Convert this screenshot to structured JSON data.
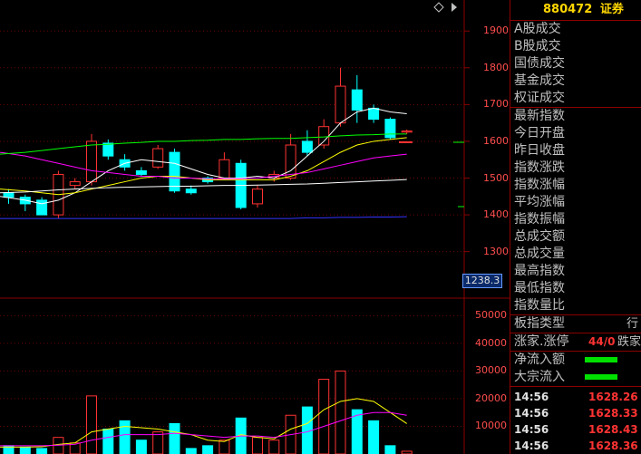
{
  "header": {
    "code": "880472",
    "name": "证券"
  },
  "price_axis": [
    "1900",
    "1800",
    "1700",
    "1600",
    "1500",
    "1400",
    "1300"
  ],
  "price_current_label": "1238.3",
  "volume_axis": [
    "50000",
    "40000",
    "30000",
    "20000",
    "10000"
  ],
  "side_groups": [
    [
      "A股成交",
      "B股成交",
      "国债成交",
      "基金成交",
      "权证成交"
    ],
    [
      "最新指数",
      "今日开盘",
      "昨日收盘",
      "指数涨跌",
      "指数涨幅",
      "平均涨幅",
      "指数振幅",
      "总成交额",
      "总成交量",
      "最高指数",
      "最低指数",
      "指数量比"
    ]
  ],
  "board_type": {
    "label": "板指类型",
    "value": "行"
  },
  "up_down": {
    "label": "涨家.涨停",
    "value": "44/0",
    "extra": "跌家"
  },
  "net_inflow": {
    "label": "净流入额"
  },
  "block_inflow": {
    "label": "大宗流入"
  },
  "ticks": [
    {
      "time": "14:56",
      "price": "1628.26"
    },
    {
      "time": "14:56",
      "price": "1628.33"
    },
    {
      "time": "14:56",
      "price": "1628.43"
    },
    {
      "time": "14:56",
      "price": "1628.36"
    }
  ],
  "chart_data": {
    "type": "candlestick",
    "ylim": [
      1240,
      1940
    ],
    "candles": [
      {
        "o": 1460,
        "c": 1448,
        "h": 1470,
        "l": 1430,
        "v": 3000
      },
      {
        "o": 1448,
        "c": 1430,
        "h": 1455,
        "l": 1410,
        "v": 2500
      },
      {
        "o": 1440,
        "c": 1400,
        "h": 1448,
        "l": 1400,
        "v": 2000
      },
      {
        "o": 1400,
        "c": 1510,
        "h": 1520,
        "l": 1390,
        "v": 6000
      },
      {
        "o": 1480,
        "c": 1490,
        "h": 1500,
        "l": 1470,
        "v": 4000
      },
      {
        "o": 1490,
        "c": 1600,
        "h": 1620,
        "l": 1480,
        "v": 21000
      },
      {
        "o": 1595,
        "c": 1560,
        "h": 1605,
        "l": 1550,
        "v": 9000
      },
      {
        "o": 1550,
        "c": 1530,
        "h": 1565,
        "l": 1520,
        "v": 12000
      },
      {
        "o": 1520,
        "c": 1510,
        "h": 1530,
        "l": 1505,
        "v": 5000
      },
      {
        "o": 1530,
        "c": 1580,
        "h": 1590,
        "l": 1525,
        "v": 8000
      },
      {
        "o": 1570,
        "c": 1465,
        "h": 1580,
        "l": 1460,
        "v": 11000
      },
      {
        "o": 1470,
        "c": 1460,
        "h": 1480,
        "l": 1455,
        "v": 2000
      },
      {
        "o": 1500,
        "c": 1490,
        "h": 1505,
        "l": 1485,
        "v": 3000
      },
      {
        "o": 1500,
        "c": 1550,
        "h": 1570,
        "l": 1495,
        "v": 5000
      },
      {
        "o": 1540,
        "c": 1420,
        "h": 1550,
        "l": 1415,
        "v": 13000
      },
      {
        "o": 1430,
        "c": 1470,
        "h": 1480,
        "l": 1420,
        "v": 6000
      },
      {
        "o": 1500,
        "c": 1510,
        "h": 1520,
        "l": 1490,
        "v": 5000
      },
      {
        "o": 1500,
        "c": 1590,
        "h": 1620,
        "l": 1495,
        "v": 14000
      },
      {
        "o": 1600,
        "c": 1570,
        "h": 1630,
        "l": 1560,
        "v": 17000
      },
      {
        "o": 1590,
        "c": 1640,
        "h": 1660,
        "l": 1580,
        "v": 27000
      },
      {
        "o": 1650,
        "c": 1750,
        "h": 1800,
        "l": 1640,
        "v": 30000
      },
      {
        "o": 1740,
        "c": 1685,
        "h": 1780,
        "l": 1650,
        "v": 16000
      },
      {
        "o": 1690,
        "c": 1660,
        "h": 1700,
        "l": 1650,
        "v": 12000
      },
      {
        "o": 1660,
        "c": 1610,
        "h": 1665,
        "l": 1605,
        "v": 3000
      },
      {
        "o": 1625,
        "c": 1628,
        "h": 1632,
        "l": 1620,
        "v": 1000
      }
    ],
    "ma_lines": [
      {
        "color": "#ffffff",
        "values": [
          1450,
          1440,
          1430,
          1440,
          1460,
          1490,
          1520,
          1540,
          1550,
          1545,
          1540,
          1525,
          1510,
          1500,
          1500,
          1505,
          1500,
          1520,
          1560,
          1600,
          1650,
          1680,
          1690,
          1680,
          1675
        ]
      },
      {
        "color": "#ffff00",
        "values": [
          1470,
          1465,
          1460,
          1455,
          1460,
          1470,
          1480,
          1490,
          1500,
          1505,
          1505,
          1500,
          1495,
          1495,
          1495,
          1495,
          1495,
          1505,
          1520,
          1545,
          1570,
          1590,
          1600,
          1605,
          1610
        ]
      },
      {
        "color": "#ff00ff",
        "values": [
          1570,
          1560,
          1550,
          1540,
          1530,
          1520,
          1515,
          1510,
          1505,
          1505,
          1500,
          1500,
          1498,
          1498,
          1498,
          1500,
          1505,
          1510,
          1515,
          1525,
          1535,
          1545,
          1555,
          1560,
          1565
        ]
      },
      {
        "color": "#00ff00",
        "values": [
          1565,
          1570,
          1575,
          1580,
          1585,
          1590,
          1592,
          1595,
          1597,
          1600,
          1600,
          1602,
          1603,
          1605,
          1605,
          1607,
          1608,
          1608,
          1610,
          1612,
          1615,
          1617,
          1618,
          1620,
          1620
        ]
      },
      {
        "color": "#ffffff",
        "values": [
          1460,
          1462,
          1465,
          1468,
          1470,
          1472,
          1474,
          1475,
          1476,
          1477,
          1478,
          1478,
          1479,
          1480,
          1480,
          1481,
          1482,
          1483,
          1484,
          1486,
          1488,
          1490,
          1492,
          1494,
          1496
        ]
      },
      {
        "color": "#3333ff",
        "values": [
          1390,
          1390,
          1390,
          1390,
          1390,
          1390,
          1390,
          1390,
          1390,
          1390,
          1390,
          1390,
          1390,
          1390,
          1390,
          1390,
          1390,
          1390,
          1392,
          1392,
          1393,
          1393,
          1394,
          1394,
          1395
        ]
      }
    ],
    "vol_ma": [
      {
        "color": "#ffff00",
        "values": [
          2500,
          2500,
          2600,
          3500,
          4000,
          8000,
          9000,
          10000,
          9500,
          9000,
          8000,
          7000,
          5000,
          4500,
          7000,
          6000,
          5500,
          9000,
          11000,
          16000,
          19000,
          20000,
          19000,
          15000,
          11000
        ]
      },
      {
        "color": "#ff00ff",
        "values": [
          3000,
          3000,
          3000,
          3200,
          3500,
          5000,
          6000,
          7000,
          7000,
          7000,
          7500,
          7000,
          6500,
          6000,
          6500,
          6500,
          6000,
          7000,
          8000,
          10000,
          12000,
          14000,
          15000,
          15000,
          14000
        ]
      }
    ],
    "vol_ylim": [
      0,
      56000
    ]
  }
}
